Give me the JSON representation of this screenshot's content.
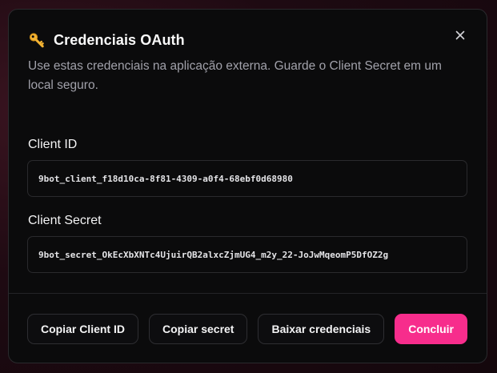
{
  "dialog": {
    "title": "Credenciais OAuth",
    "description": "Use estas credenciais na aplicação externa. Guarde o Client Secret em um local seguro.",
    "icon": "key-icon",
    "close_icon": "close-icon"
  },
  "fields": {
    "client_id": {
      "label": "Client ID",
      "value": "9bot_client_f18d10ca-8f81-4309-a0f4-68ebf0d68980"
    },
    "client_secret": {
      "label": "Client Secret",
      "value": "9bot_secret_OkEcXbXNTc4UjuirQB2alxcZjmUG4_m2y_22-JoJwMqeomP5DfOZ2g"
    }
  },
  "footer": {
    "copy_id_label": "Copiar Client ID",
    "copy_secret_label": "Copiar secret",
    "download_label": "Baixar credenciais",
    "done_label": "Concluir"
  },
  "colors": {
    "accent": "#f72d8c",
    "background": "#0b0b0c",
    "border": "#2a2a2d",
    "muted_text": "#a1a1aa"
  }
}
